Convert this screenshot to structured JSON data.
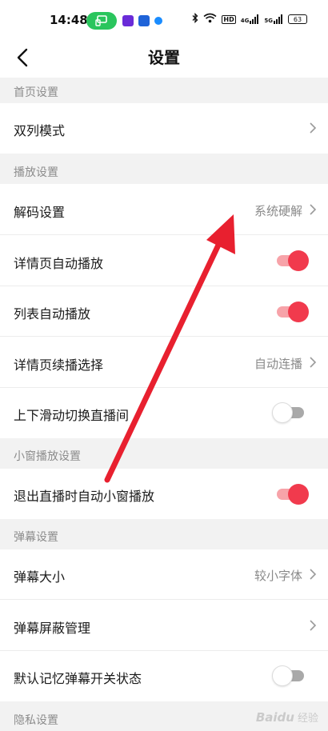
{
  "status_bar": {
    "time": "14:48",
    "battery": "63",
    "right_icons": [
      "bluetooth-icon",
      "wifi-icon",
      "hd-icon",
      "signal-4g-icon",
      "signal-5g-icon"
    ],
    "hd_label": "HD",
    "net1": "4G",
    "net2": "5G"
  },
  "nav": {
    "title": "设置",
    "back_icon": "chevron-left-icon"
  },
  "sections": {
    "home": {
      "header": "首页设置",
      "items": [
        {
          "label": "双列模式",
          "value": "",
          "control": "chevron"
        }
      ]
    },
    "playback": {
      "header": "播放设置",
      "items": [
        {
          "label": "解码设置",
          "value": "系统硬解",
          "control": "chevron"
        },
        {
          "label": "详情页自动播放",
          "value": "",
          "control": "toggle",
          "on": true
        },
        {
          "label": "列表自动播放",
          "value": "",
          "control": "toggle",
          "on": true
        },
        {
          "label": "详情页续播选择",
          "value": "自动连播",
          "control": "chevron"
        },
        {
          "label": "上下滑动切换直播间",
          "value": "",
          "control": "toggle",
          "on": false
        }
      ]
    },
    "miniwindow": {
      "header": "小窗播放设置",
      "items": [
        {
          "label": "退出直播时自动小窗播放",
          "value": "",
          "control": "toggle",
          "on": true
        }
      ]
    },
    "danmaku": {
      "header": "弹幕设置",
      "items": [
        {
          "label": "弹幕大小",
          "value": "较小字体",
          "control": "chevron"
        },
        {
          "label": "弹幕屏蔽管理",
          "value": "",
          "control": "chevron"
        },
        {
          "label": "默认记忆弹幕开关状态",
          "value": "",
          "control": "toggle",
          "on": false
        }
      ]
    },
    "privacy": {
      "header": "隐私设置"
    }
  },
  "colors": {
    "toggle_on_track": "#f7a3a9",
    "toggle_on_knob": "#f13a4d",
    "annotation_arrow": "#e8202f"
  },
  "watermark": {
    "logo": "Baidu",
    "text": "经验"
  }
}
